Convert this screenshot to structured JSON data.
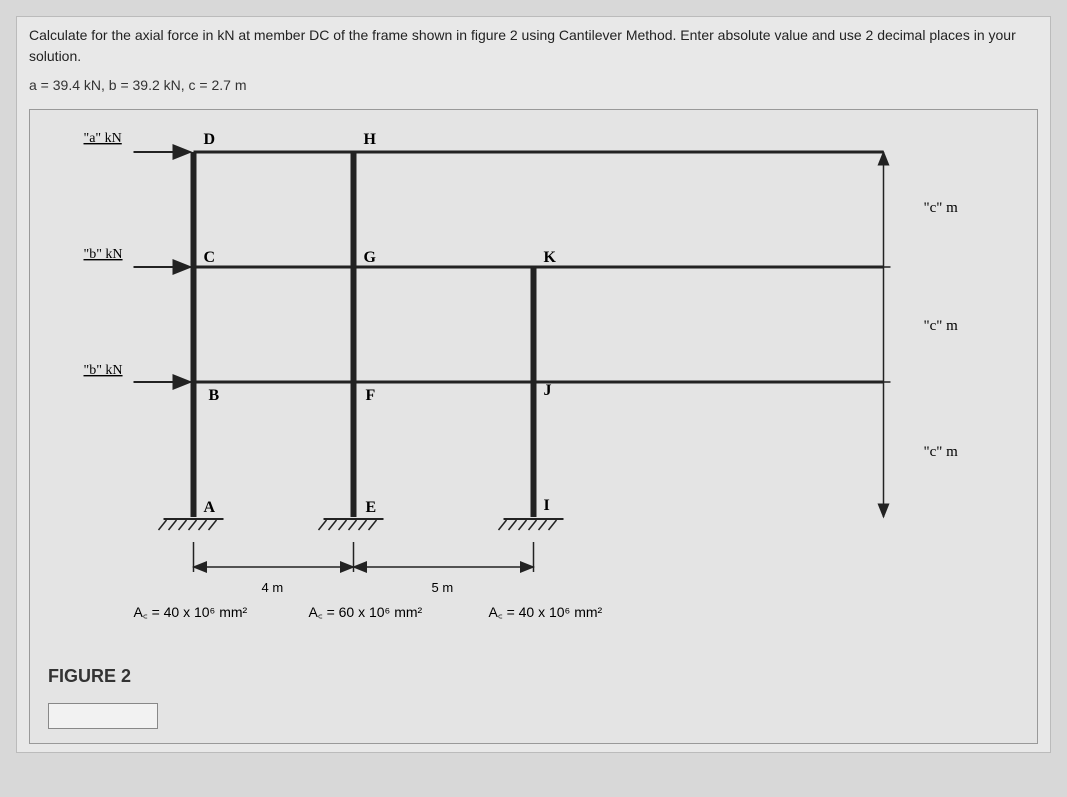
{
  "question": "Calculate for the axial force in kN at member DC of the frame shown in figure 2 using Cantilever Method. Enter absolute value and use 2 decimal places in your solution.",
  "parameters": "a = 39.4 kN, b = 39.2 kN, c = 2.7 m",
  "loads": {
    "top": "\"a\" kN",
    "mid": "\"b\" kN",
    "low": "\"b\" kN"
  },
  "nodes": {
    "D": "D",
    "H": "H",
    "C": "C",
    "G": "G",
    "K": "K",
    "B": "B",
    "F": "F",
    "J": "J",
    "A": "A",
    "E": "E",
    "I": "I"
  },
  "heights": {
    "h1": "\"c\" m",
    "h2": "\"c\" m",
    "h3": "\"c\" m"
  },
  "spans": {
    "s1": "4 m",
    "s2": "5 m"
  },
  "areas": {
    "a1": "A꜀ = 40 x 10⁶ mm²",
    "a2": "A꜀ = 60 x 10⁶ mm²",
    "a3": "A꜀ = 40 x 10⁶ mm²"
  },
  "figure_label": "FIGURE 2",
  "answer": ""
}
